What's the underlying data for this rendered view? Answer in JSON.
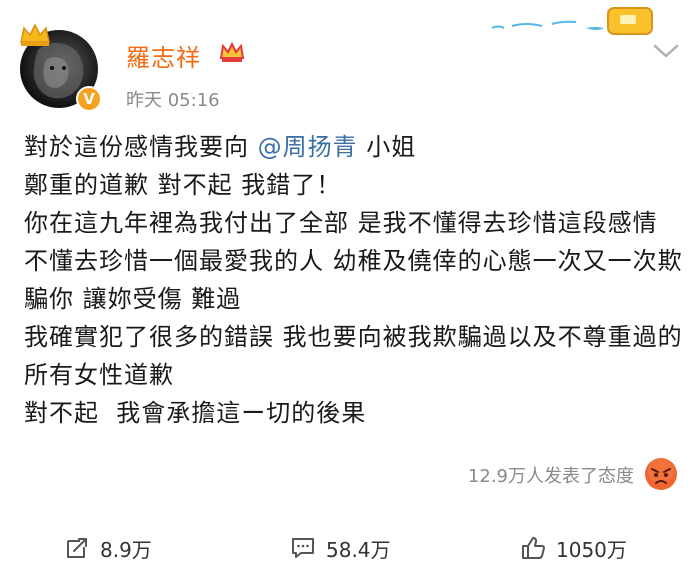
{
  "post": {
    "username": "羅志祥",
    "time": "昨天 05:16",
    "content_line1_prefix": "對於這份感情我要向 ",
    "mention": "@周扬青",
    "content_line1_suffix": " 小姐",
    "content_rest": "鄭重的道歉 對不起 我錯了！\n你在這九年裡為我付出了全部 是我不懂得去珍惜這段感情 不懂去珍惜一個最愛我的人 幼稚及僥倖的心態一次又一次欺騙你 讓妳受傷 難過\n我確實犯了很多的錯誤 我也要向被我欺騙過以及不尊重過的所有女性道歉\n對不起  我會承擔這ー切的後果"
  },
  "reactions": {
    "summary": "12.9万人发表了态度",
    "emoji_icon": "angry-face-icon"
  },
  "actions": {
    "repost_count": "8.9万",
    "comment_count": "58.4万",
    "like_count": "1050万"
  },
  "colors": {
    "username": "#f86a0e",
    "mention": "#3b6ea5",
    "verify_badge": "#f4a21f"
  }
}
